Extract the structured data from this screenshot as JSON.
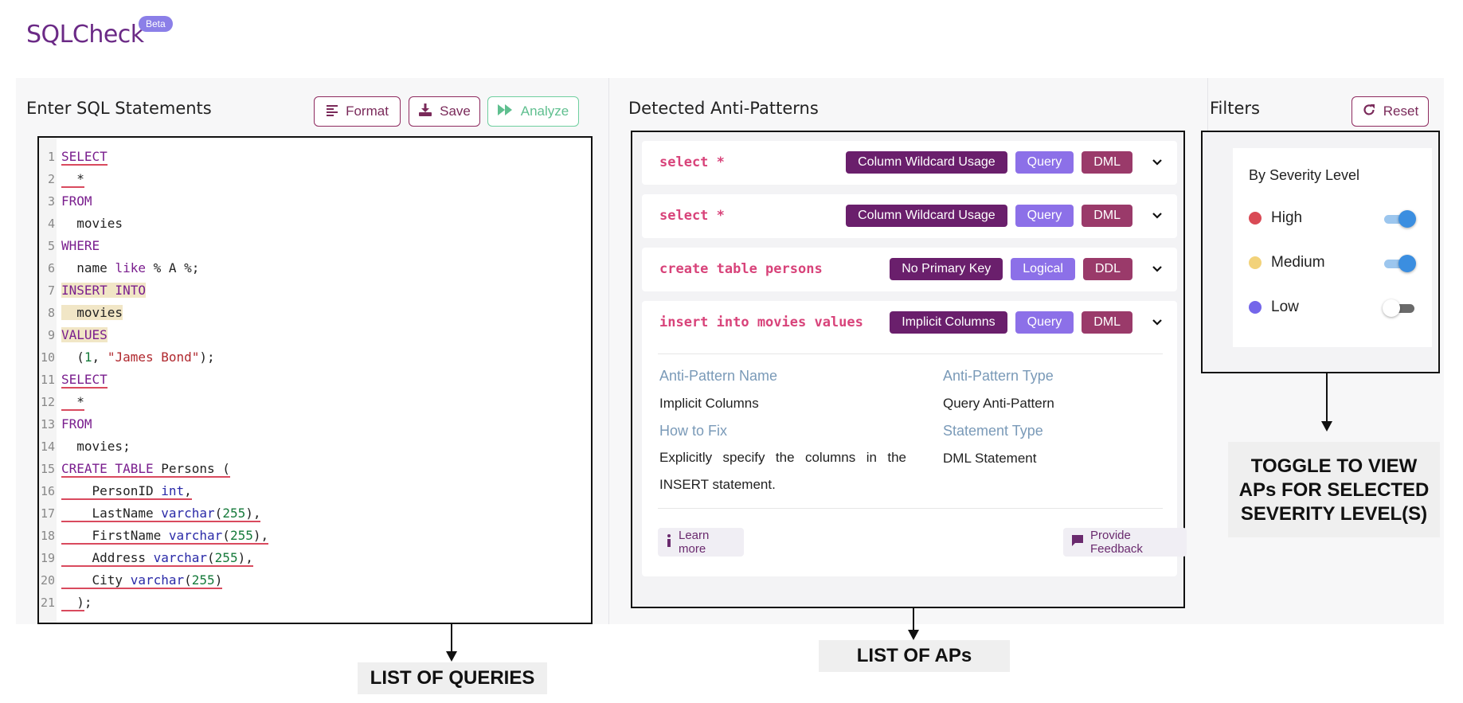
{
  "brand": {
    "name": "SQLCheck",
    "badge": "Beta"
  },
  "editor": {
    "title": "Enter SQL Statements",
    "buttons": {
      "format": "Format",
      "save": "Save",
      "analyze": "Analyze"
    },
    "line_numbers": [
      "1",
      "2",
      "3",
      "4",
      "5",
      "6",
      "7",
      "8",
      "9",
      "10",
      "11",
      "12",
      "13",
      "14",
      "15",
      "16",
      "17",
      "18",
      "19",
      "20",
      "21"
    ]
  },
  "antipatterns": {
    "title": "Detected Anti-Patterns",
    "items": [
      {
        "query": "select *",
        "name": "Column Wildcard Usage",
        "type": "Query",
        "category": "DML"
      },
      {
        "query": "select *",
        "name": "Column Wildcard Usage",
        "type": "Query",
        "category": "DML"
      },
      {
        "query": "create table persons",
        "name": "No Primary Key",
        "type": "Logical",
        "category": "DDL"
      },
      {
        "query": "insert into movies values",
        "name": "Implicit Columns",
        "type": "Query",
        "category": "DML"
      }
    ],
    "detail": {
      "name_label": "Anti-Pattern Name",
      "name_value": "Implicit Columns",
      "type_label": "Anti-Pattern Type",
      "type_value": "Query Anti-Pattern",
      "fix_label": "How to Fix",
      "fix_value": "Explicitly specify the columns in the INSERT statement.",
      "stmt_label": "Statement Type",
      "stmt_value": "DML Statement",
      "learn_more": "Learn more",
      "feedback": "Provide Feedback"
    }
  },
  "filters": {
    "title": "Filters",
    "reset": "Reset",
    "severity_title": "By Severity Level",
    "levels": [
      {
        "label": "High",
        "color": "#d94a55",
        "on": true
      },
      {
        "label": "Medium",
        "color": "#f2d27a",
        "on": true
      },
      {
        "label": "Low",
        "color": "#7466ea",
        "on": false
      }
    ]
  },
  "annotations": {
    "queries": "LIST OF QUERIES",
    "aps": "LIST OF APs",
    "toggle_line1": "TOGGLE TO VIEW",
    "toggle_line2": "APs FOR SELECTED",
    "toggle_line3": "SEVERITY LEVEL(S)"
  },
  "colors": {
    "accent": "#7a2a5a",
    "brand": "#6b2a86",
    "toggle_on": "#3b8ee0"
  }
}
